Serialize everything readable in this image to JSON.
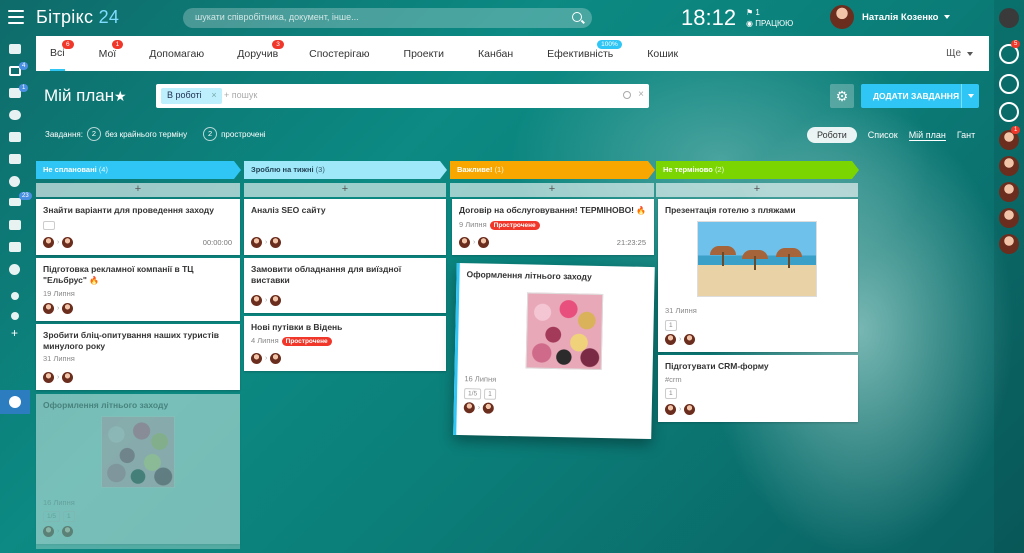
{
  "header": {
    "logo_main": "Бітрікс",
    "logo_num": "24",
    "search_placeholder": "шукати співробітника, документ, інше...",
    "clock": "18:12",
    "flag_count": "1",
    "work_status": "ПРАЦЮЮ",
    "user_name": "Наталія Козенко"
  },
  "leftbar": {
    "badges": [
      "4",
      "1",
      "23"
    ]
  },
  "rightbar": {
    "badges": [
      "5",
      "1"
    ]
  },
  "tabs": [
    {
      "label": "Всі",
      "badge": "6"
    },
    {
      "label": "Мої",
      "badge": "1"
    },
    {
      "label": "Допомагаю",
      "badge": ""
    },
    {
      "label": "Доручив",
      "badge": "3"
    },
    {
      "label": "Спостерігаю",
      "badge": ""
    },
    {
      "label": "Проекти",
      "badge": ""
    },
    {
      "label": "Канбан",
      "badge": ""
    },
    {
      "label": "Ефективність",
      "badge": "100%"
    },
    {
      "label": "Кошик",
      "badge": ""
    }
  ],
  "tabs_more": "Ще",
  "page": {
    "title": "Мій план",
    "filter_chip": "В роботі",
    "filter_placeholder": "+ пошук",
    "add_task": "ДОДАТИ ЗАВДАННЯ"
  },
  "counters": {
    "label": "Завдання:",
    "no_deadline_count": "2",
    "no_deadline_label": "без крайнього терміну",
    "overdue_count": "2",
    "overdue_label": "прострочені"
  },
  "views": [
    "Роботи",
    "Список",
    "Мій план",
    "Гант"
  ],
  "columns": [
    {
      "name": "Не сплановані",
      "count": "(4)",
      "color": "#2fc6f6"
    },
    {
      "name": "Зроблю на тижні",
      "count": "(3)",
      "color": "#9ee8fa"
    },
    {
      "name": "Важливе!",
      "count": "(1)",
      "color": "#f7a700"
    },
    {
      "name": "Не терміново",
      "count": "(2)",
      "color": "#7bd500"
    }
  ],
  "cards": {
    "c1": {
      "title": "Знайти варіанти для проведення заходу",
      "time": "00:00:00"
    },
    "c2": {
      "title": "Підготовка рекламної компанії в ТЦ \"Ельбрус\"",
      "date": "19 Липня"
    },
    "c3": {
      "title": "Зробити бліц-опитування наших туристів минулого року",
      "date": "31 Липня"
    },
    "c4": {
      "title": "Оформлення літнього заходу",
      "date": "16 Липня",
      "checks": "1/5",
      "files": "1"
    },
    "c5": {
      "title": "Аналіз SEO сайту"
    },
    "c6": {
      "title": "Замовити обладнання для виїздної виставки"
    },
    "c7": {
      "title": "Нові путівки в Відень",
      "date": "4 Липня",
      "status": "Прострочене"
    },
    "c8": {
      "title": "Договір на обслуговування! ТЕРМІНОВО!",
      "date": "9 Липня",
      "status": "Прострочене",
      "time": "21:23:25"
    },
    "c9": {
      "title": "Оформлення літнього заходу",
      "date": "16 Липня",
      "checks": "1/5",
      "files": "1"
    },
    "c10": {
      "title": "Презентація готелю з пляжами",
      "date": "31 Липня",
      "files": "1"
    },
    "c11": {
      "title": "Підготувати CRM-форму",
      "tag": "#crm",
      "files": "1"
    }
  }
}
